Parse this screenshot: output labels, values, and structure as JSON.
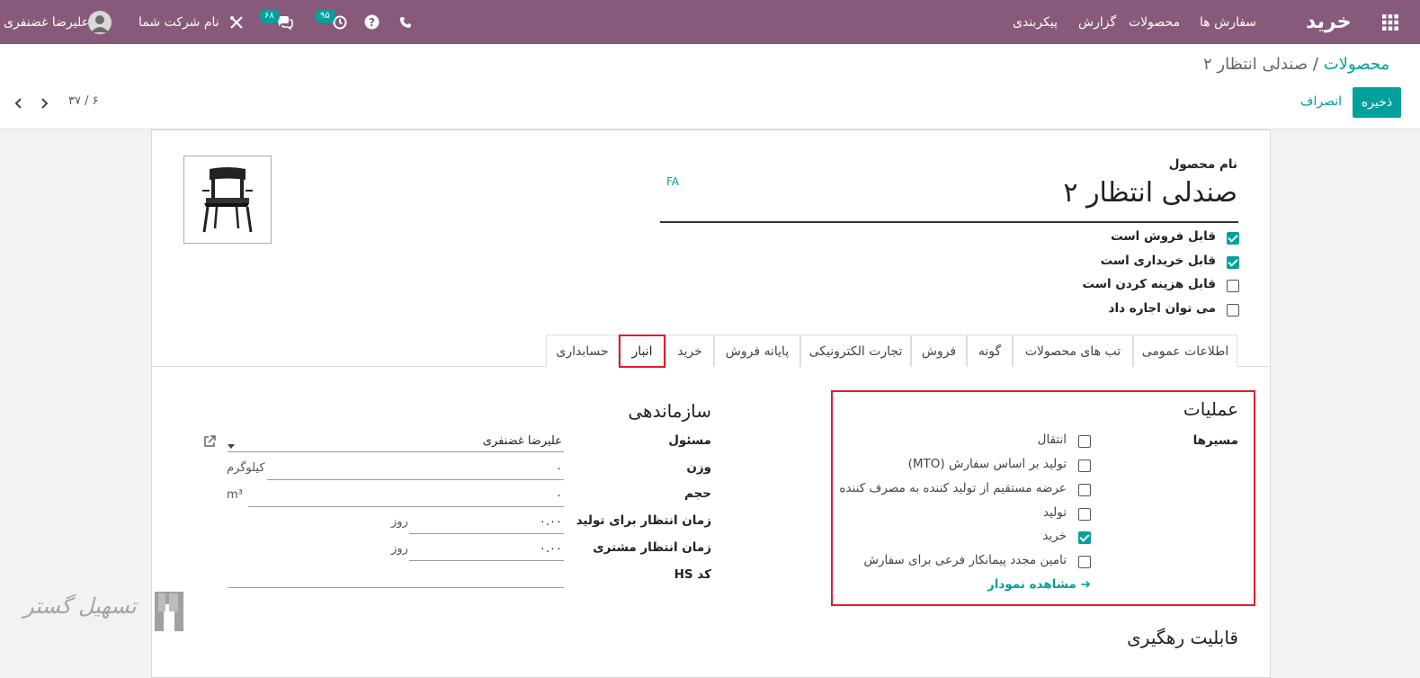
{
  "topbar": {
    "app_name": "خرید",
    "menu": [
      "سفارش ها",
      "محصولات",
      "گزارش",
      "پیکربندی"
    ],
    "company": "نام شرکت شما",
    "user": "علیرضا غضنفری",
    "messages_count": "۶۸",
    "activities_count": "۹۵",
    "icons": [
      "apps-grid-icon",
      "phone-icon",
      "help-icon",
      "clock-icon",
      "chat-icon",
      "debug-icon",
      "avatar"
    ]
  },
  "breadcrumb": {
    "parent": "محصولات",
    "separator": "/",
    "current": "صندلی انتظار ۲"
  },
  "actions": {
    "save": "ذخیره",
    "discard": "انصراف"
  },
  "pager": {
    "text": "۶ / ۳۷"
  },
  "product": {
    "name_label": "نام محصول",
    "name": "صندلی انتظار ۲",
    "lang": "FA",
    "options": [
      {
        "label": "قابل فروش است",
        "checked": true
      },
      {
        "label": "قابل خریداری است",
        "checked": true
      },
      {
        "label": "قابل هزینه کردن است",
        "checked": false
      },
      {
        "label": "می توان اجاره داد",
        "checked": false
      }
    ]
  },
  "tabs": [
    "اطلاعات عمومی",
    "تب های محصولات",
    "گونه",
    "فروش",
    "تجارت الکترونیکی",
    "پایانه فروش",
    "خرید",
    "انبار",
    "حسابداری"
  ],
  "active_tab": "انبار",
  "operations": {
    "title": "عملیات",
    "routes_label": "مسیرها",
    "routes": [
      {
        "label": "انتقال",
        "checked": false
      },
      {
        "label": "تولید بر اساس سفارش (MTO)",
        "checked": false
      },
      {
        "label": "عرضه مستقیم از تولید کننده به مصرف کننده",
        "checked": false
      },
      {
        "label": "تولید",
        "checked": false
      },
      {
        "label": "خرید",
        "checked": true
      },
      {
        "label": "تامین مجدد پیمانکار فرعی برای سفارش",
        "checked": false
      }
    ],
    "diagram_link": "مشاهده نمودار"
  },
  "organization": {
    "title": "سازماندهی",
    "responsible_label": "مسئول",
    "responsible_value": "علیرضا غضنفری",
    "weight_label": "وزن",
    "weight_value": "۰",
    "weight_unit": "کیلوگرم",
    "volume_label": "حجم",
    "volume_value": "۰",
    "volume_unit": "m³",
    "mfg_lead_label": "زمان انتظار برای تولید",
    "mfg_lead_value": "۰.۰۰",
    "mfg_lead_unit": "روز",
    "cust_lead_label": "زمان انتظار مشتری",
    "cust_lead_value": "۰.۰۰",
    "cust_lead_unit": "روز",
    "hs_label": "کد HS",
    "hs_value": ""
  },
  "traceability": {
    "title": "قابلیت رهگیری"
  },
  "watermark": "تسهیل گستر"
}
